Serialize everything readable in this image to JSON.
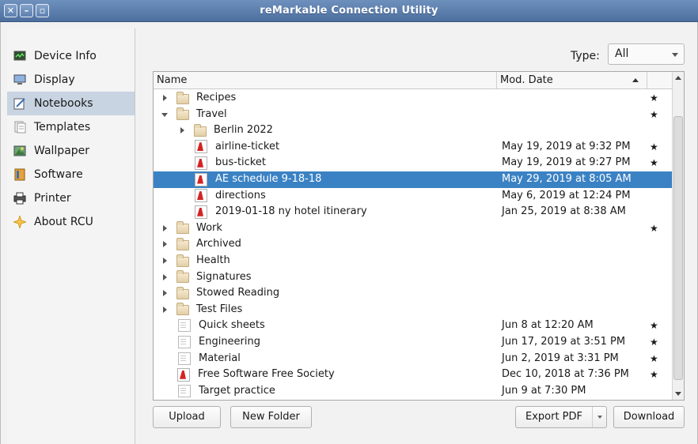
{
  "window": {
    "title": "reMarkable Connection Utility"
  },
  "sidebar": {
    "items": [
      {
        "label": "Device Info",
        "icon": "monitor-icon"
      },
      {
        "label": "Display",
        "icon": "display-icon"
      },
      {
        "label": "Notebooks",
        "icon": "notebook-icon",
        "active": true
      },
      {
        "label": "Templates",
        "icon": "templates-icon"
      },
      {
        "label": "Wallpaper",
        "icon": "wallpaper-icon"
      },
      {
        "label": "Software",
        "icon": "software-icon"
      },
      {
        "label": "Printer",
        "icon": "printer-icon"
      },
      {
        "label": "About RCU",
        "icon": "star-icon"
      }
    ]
  },
  "filter": {
    "type_label": "Type:",
    "type_value": "All"
  },
  "tree": {
    "columns": {
      "name": "Name",
      "date": "Mod. Date"
    },
    "rows": [
      {
        "name": "Recipes",
        "kind": "folder",
        "depth": 0,
        "expander": "closed",
        "date": "",
        "star": "★"
      },
      {
        "name": "Travel",
        "kind": "folder",
        "depth": 0,
        "expander": "open",
        "date": "",
        "star": "★"
      },
      {
        "name": "Berlin 2022",
        "kind": "folder",
        "depth": 1,
        "expander": "closed",
        "date": "",
        "star": ""
      },
      {
        "name": "airline-ticket",
        "kind": "pdf",
        "depth": 1,
        "expander": "",
        "date": "May 19, 2019 at 9:32 PM",
        "star": "★"
      },
      {
        "name": "bus-ticket",
        "kind": "pdf",
        "depth": 1,
        "expander": "",
        "date": "May 19, 2019 at 9:27 PM",
        "star": "★"
      },
      {
        "name": "AE schedule 9-18-18",
        "kind": "pdf",
        "depth": 1,
        "expander": "",
        "date": "May 29, 2019 at 8:05 AM",
        "star": "",
        "selected": true
      },
      {
        "name": "directions",
        "kind": "pdf",
        "depth": 1,
        "expander": "",
        "date": "May 6, 2019 at 12:24 PM",
        "star": ""
      },
      {
        "name": "2019-01-18 ny hotel itinerary",
        "kind": "pdf",
        "depth": 1,
        "expander": "",
        "date": "Jan 25, 2019 at 8:38 AM",
        "star": ""
      },
      {
        "name": "Work",
        "kind": "folder",
        "depth": 0,
        "expander": "closed",
        "date": "",
        "star": "★"
      },
      {
        "name": "Archived",
        "kind": "folder",
        "depth": 0,
        "expander": "closed",
        "date": "",
        "star": ""
      },
      {
        "name": "Health",
        "kind": "folder",
        "depth": 0,
        "expander": "closed",
        "date": "",
        "star": ""
      },
      {
        "name": "Signatures",
        "kind": "folder",
        "depth": 0,
        "expander": "closed",
        "date": "",
        "star": ""
      },
      {
        "name": "Stowed Reading",
        "kind": "folder",
        "depth": 0,
        "expander": "closed",
        "date": "",
        "star": ""
      },
      {
        "name": "Test Files",
        "kind": "folder",
        "depth": 0,
        "expander": "closed",
        "date": "",
        "star": ""
      },
      {
        "name": "Quick sheets",
        "kind": "notebook",
        "depth": 0,
        "expander": "",
        "date": "Jun 8 at 12:20 AM",
        "star": "★"
      },
      {
        "name": "Engineering",
        "kind": "notebook",
        "depth": 0,
        "expander": "",
        "date": "Jun 17, 2019 at 3:51 PM",
        "star": "★"
      },
      {
        "name": "Material",
        "kind": "notebook",
        "depth": 0,
        "expander": "",
        "date": "Jun 2, 2019 at 3:31 PM",
        "star": "★"
      },
      {
        "name": "Free Software Free Society",
        "kind": "pdf",
        "depth": 0,
        "expander": "",
        "date": "Dec 10, 2018 at 7:36 PM",
        "star": "★"
      },
      {
        "name": "Target practice",
        "kind": "notebook",
        "depth": 0,
        "expander": "",
        "date": "Jun 9 at 7:30 PM",
        "star": ""
      }
    ]
  },
  "buttons": {
    "upload": "Upload",
    "new_folder": "New Folder",
    "export_pdf": "Export PDF",
    "download": "Download"
  },
  "colors": {
    "titlebar": "#5a7cab",
    "selection": "#3b82c4",
    "sidebar_active": "#c8d4e2",
    "pdf_icon": "#d42424"
  }
}
